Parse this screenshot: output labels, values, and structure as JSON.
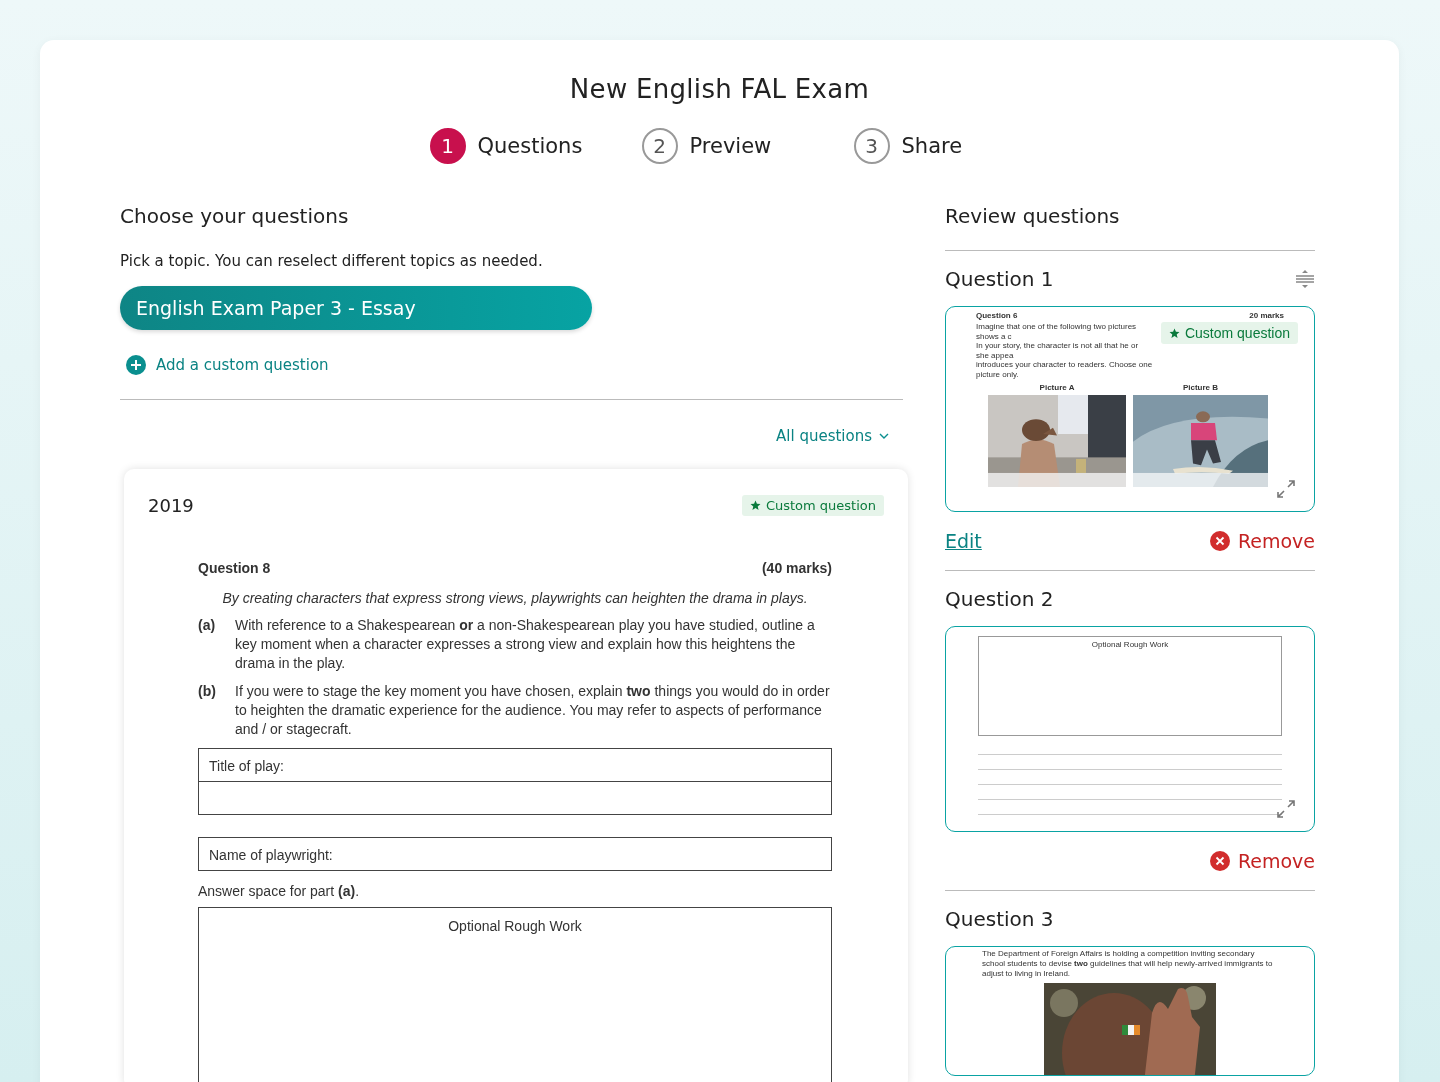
{
  "title": "New English FAL Exam",
  "steps": [
    {
      "number": "1",
      "label": "Questions",
      "selected": true
    },
    {
      "number": "2",
      "label": "Preview",
      "selected": false
    },
    {
      "number": "3",
      "label": "Share",
      "selected": false
    }
  ],
  "chooser": {
    "heading": "Choose your questions",
    "instruction": "Pick a topic. You can reselect different topics as needed.",
    "topic": "English Exam Paper 3 - Essay",
    "add_link": "Add a custom question",
    "filter": "All questions",
    "question_card": {
      "year": "2019",
      "badge": "Custom question",
      "question_label": "Question 8",
      "marks": "(40 marks)",
      "prompt": "By creating characters that express strong views, playwrights can heighten the drama in plays.",
      "parts": [
        {
          "label": "(a)",
          "text": "With reference to a Shakespearean **or** a non-Shakespearean play you have studied, outline a key moment when a character expresses a strong view and explain how this heightens the drama in the play."
        },
        {
          "label": "(b)",
          "text": "If you were to stage the key moment you have chosen, explain **two** things you would do in order to heighten the dramatic experience for the audience.  You may refer to aspects of performance and / or stagecraft."
        }
      ],
      "fields": [
        {
          "label": "Title of play:",
          "extra_row": true
        },
        {
          "label": "Name of playwright:",
          "extra_row": false
        }
      ],
      "answer_note": "Answer space for part **(a)**.",
      "rough_work": "Optional Rough Work"
    }
  },
  "review": {
    "heading": "Review questions",
    "questions": [
      {
        "title": "Question 1",
        "drag_handle": true,
        "kind": "pictures",
        "badge": "Custom question",
        "edit": "Edit",
        "remove": "Remove",
        "paper_label": "Question 6",
        "marks": "20 marks",
        "lines": [
          "Imagine that one of the following two pictures shows a c",
          "In your story, the character is not all that he or she appea",
          "introduces your character to readers.  Choose one picture only."
        ],
        "picture_labels": [
          "Picture A",
          "Picture B"
        ]
      },
      {
        "title": "Question 2",
        "drag_handle": false,
        "kind": "rough_work",
        "remove": "Remove",
        "box_label": "Optional Rough Work"
      },
      {
        "title": "Question 3",
        "drag_handle": false,
        "kind": "photo_prompt",
        "text": "The Department of Foreign Affairs is holding a competition inviting secondary school students to devise **two** guidelines that will help newly-arrived immigrants to adjust to living in Ireland."
      }
    ]
  }
}
